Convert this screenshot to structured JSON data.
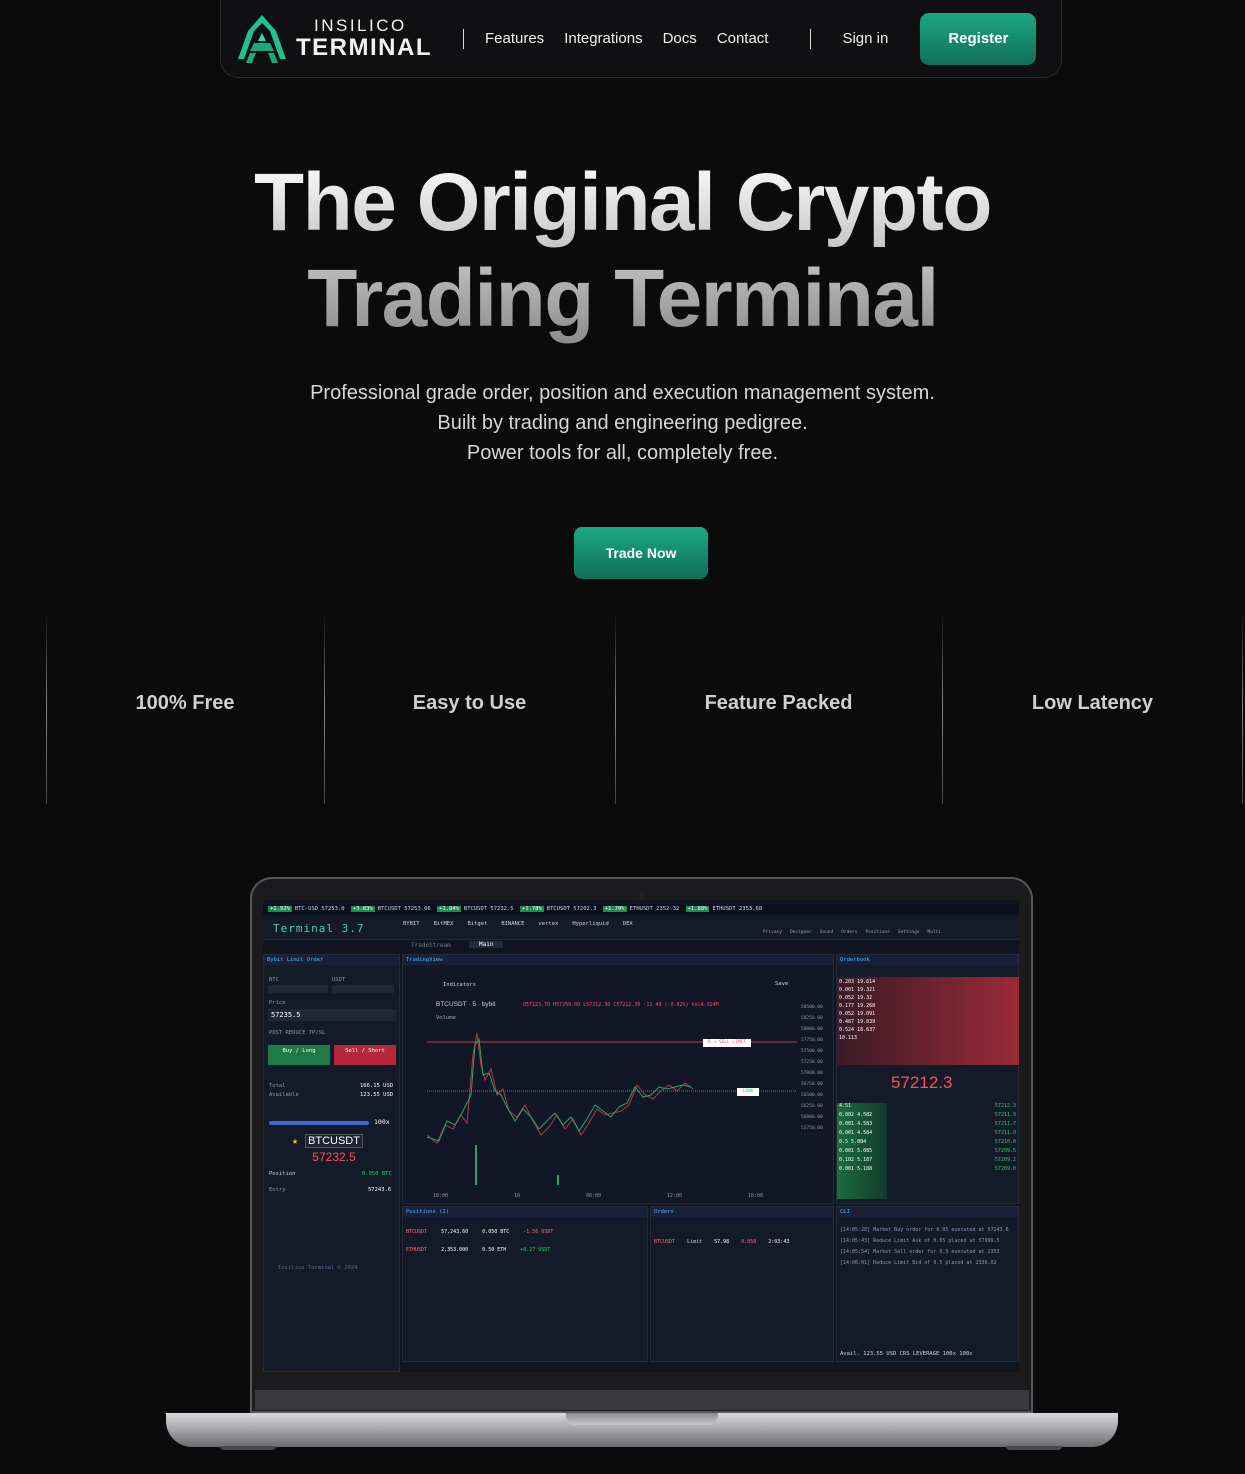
{
  "nav": {
    "logo_top": "INSILICO",
    "logo_bottom": "TERMINAL",
    "links": [
      "Features",
      "Integrations",
      "Docs",
      "Contact"
    ],
    "signin": "Sign in",
    "register": "Register"
  },
  "hero": {
    "title_line1": "The Original Crypto",
    "title_line2": "Trading Terminal",
    "sub_line1": "Professional grade order, position and execution management system.",
    "sub_line2": "Built by trading and engineering pedigree.",
    "sub_line3": "Power tools for all, completely free.",
    "cta": "Trade Now"
  },
  "features": [
    "100% Free",
    "Easy to Use",
    "Feature Packed",
    "Low Latency"
  ],
  "screen": {
    "ticker": [
      {
        "badge": "+1.92%",
        "text": "BTC-USD 57253.0"
      },
      {
        "badge": "+3.83%",
        "text": "BTCUSDT 57253.66"
      },
      {
        "badge": "+1.84%",
        "text": "BTCUSDT 57232.5"
      },
      {
        "badge": "+1.78%",
        "text": "BTCUSDT 57202.3"
      },
      {
        "badge": "+1.70%",
        "text": "ETHUSDT 2352.32"
      },
      {
        "badge": "+1.88%",
        "text": "ETHUSDT 2353.68"
      }
    ],
    "app_title": "Terminal 3.7",
    "tabs": [
      "TradeStream",
      "Main"
    ],
    "exchanges": [
      "BYBIT",
      "BitMEX",
      "Bitget",
      "BINANCE",
      "vertex",
      "Hyperliquid",
      "DEX"
    ],
    "toolbar": [
      "Privacy",
      "Designer",
      "Sound",
      "Orders",
      "Positions",
      "Settings",
      "Multi"
    ],
    "order": {
      "header": "Bybit Limit Order",
      "base": "BTC",
      "quote": "USDT",
      "price_label": "Price",
      "price": "57235.5",
      "options": "POST  REDUCE  TP/SL",
      "buy": "Buy / Long",
      "sell": "Sell / Short",
      "total_label": "Total",
      "total": "166.15 USD",
      "available_label": "Available",
      "available": "123.55 USD",
      "leverage": "100x",
      "symbol": "BTCUSDT",
      "symbol_price": "57232.5",
      "position_label": "Position",
      "position": "0.050 BTC",
      "entry_label": "Entry",
      "entry": "57243.6",
      "footer": "Insilico Terminal © 2024"
    },
    "chart": {
      "header": "TradingView",
      "title": "BTCUSDT · 5 · bybit",
      "ohlc": "O57223.70 H57250.00 L57212.30 C57212.30 -11.40 (-0.02%) Vol4.324M",
      "volume_label": "Volume",
      "indicators": "Indicators",
      "save": "Save",
      "sell_limit": "0 × SELL LIMIT",
      "long": "LONG",
      "time_labels": [
        "18:00",
        "10",
        "06:00",
        "12:00",
        "18:00"
      ],
      "price_labels": [
        "58500.00",
        "58250.00",
        "58000.00",
        "57750.00",
        "57500.00",
        "57250.00",
        "57000.00",
        "56750.00",
        "56500.00",
        "56250.00",
        "56000.00",
        "55750.00"
      ]
    },
    "orderbook": {
      "header": "Orderbook",
      "asks": [
        [
          "0.203",
          "19.614"
        ],
        [
          "0.001",
          "19.321"
        ],
        [
          "0.052",
          "19.32"
        ],
        [
          "0.177",
          "19.268"
        ],
        [
          "0.052",
          "19.091"
        ],
        [
          "0.487",
          "19.039"
        ],
        [
          "0.524",
          "18.637"
        ],
        [
          "10.113",
          ""
        ]
      ],
      "mid_price": "57212.3",
      "bids": [
        [
          "4.51",
          ""
        ],
        [
          "0.002",
          "4.582"
        ],
        [
          "0.001",
          "4.583"
        ],
        [
          "0.001",
          "4.584"
        ],
        [
          "0.5",
          "5.084"
        ],
        [
          "0.001",
          "5.085"
        ],
        [
          "0.102",
          "5.187"
        ],
        [
          "0.001",
          "5.188"
        ]
      ],
      "bid_prices": [
        "57212.3",
        "57211.9",
        "57211.7",
        "57211.0",
        "57210.0",
        "57209.5",
        "57209.2",
        "57209.0"
      ]
    },
    "positions": {
      "header": "Positions (2)",
      "rows": [
        [
          "BTCUSDT",
          "57,243.60",
          "0.050 BTC",
          "-1.56 USDT"
        ],
        [
          "ETHUSDT",
          "2,353.000",
          "0.50 ETH",
          "+0.27 USDT"
        ]
      ]
    },
    "orders": {
      "header": "Orders",
      "row": [
        "BTCUSDT",
        "Limit",
        "57.98",
        "0.050",
        "2:03:43"
      ]
    },
    "cli": {
      "header": "CLI",
      "lines": [
        "[14:05:28] Market Buy order for 0.05 executed at 57243.6",
        "[14:05:43] Reduce Limit Ask of 0.05 placed at 57999.5",
        "[14:05:54] Market Sell order for 0.5 executed at 2353",
        "[14:06:01] Reduce Limit Bid of 0.5 placed at 2330.02"
      ],
      "status": "Avail. 123.55 USD  CRS  LEVERAGE 100x 100x"
    }
  },
  "colors": {
    "accent": "#1da885",
    "accent_dark": "#0f6f57",
    "bg": "#0b0b0c",
    "sell": "#ff4d5e",
    "buy": "#2ecc71",
    "terminal_green": "#4fd1a5"
  }
}
